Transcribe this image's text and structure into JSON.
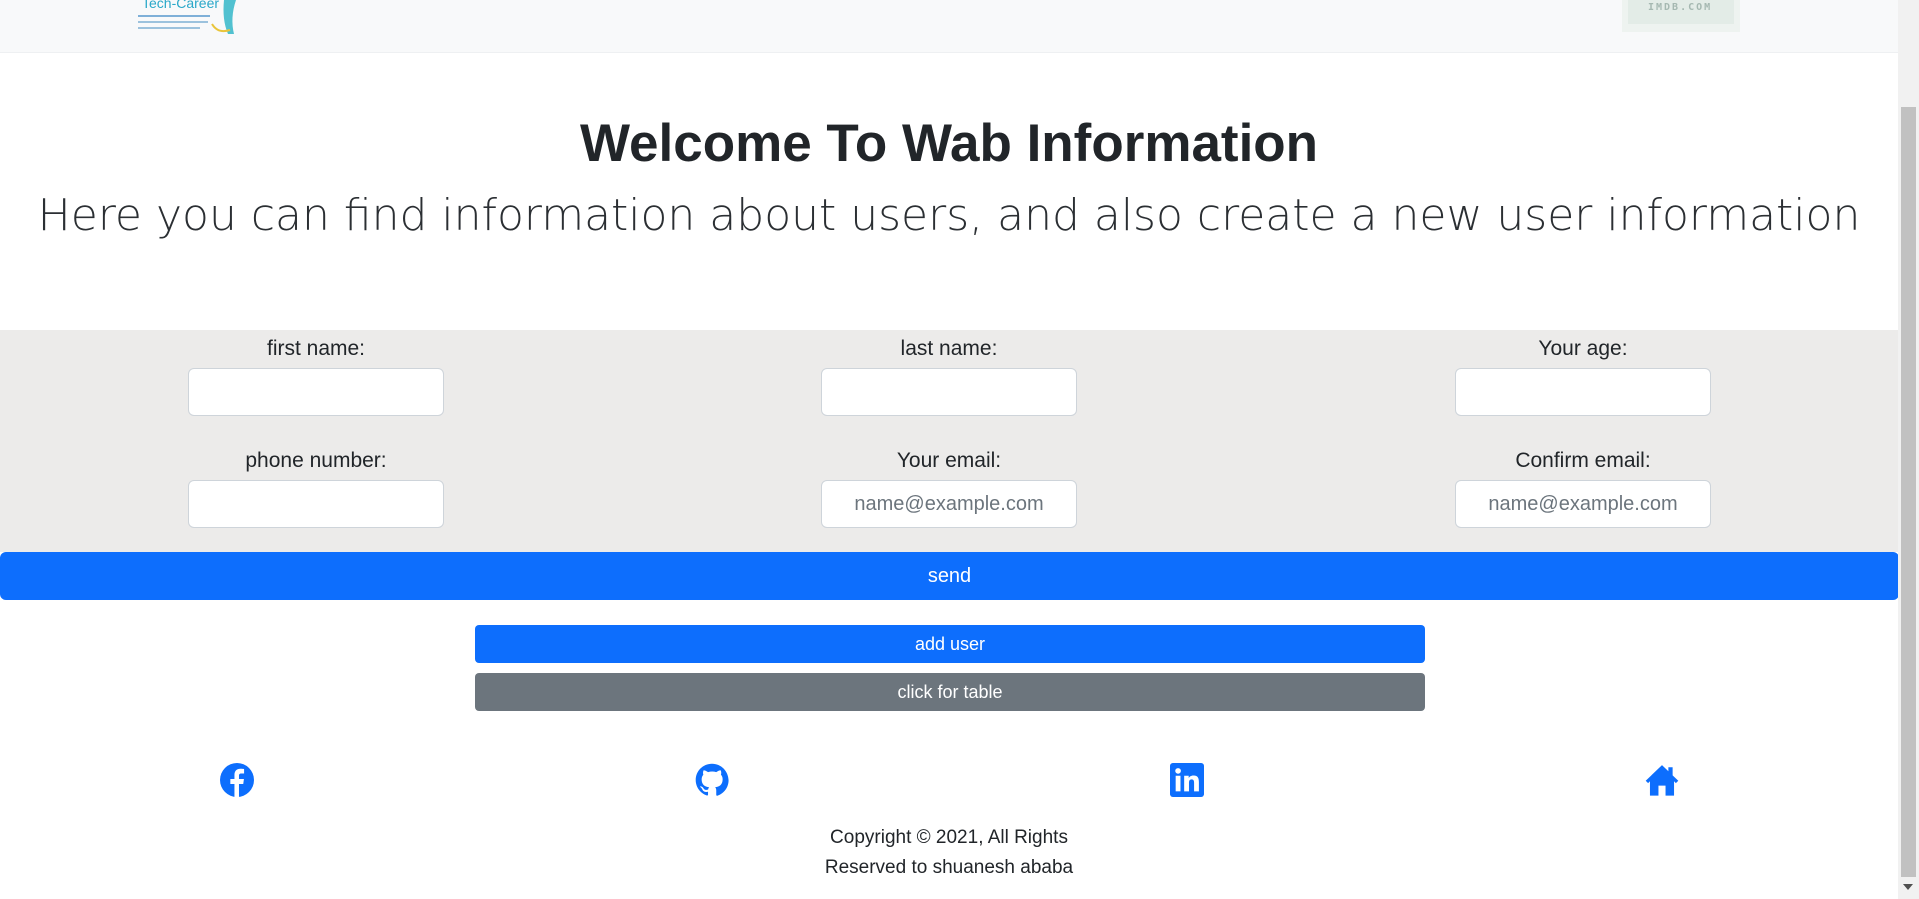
{
  "navbar": {
    "logo_left_alt": "Tech-Career",
    "logo_right_text": "IMDB.COM"
  },
  "header": {
    "title": "Welcome To Wab Information",
    "subtitle": "Here you can find information about users, and also create a new user information"
  },
  "form": {
    "fields": [
      {
        "label": "first name:",
        "placeholder": "",
        "value": ""
      },
      {
        "label": "last name:",
        "placeholder": "",
        "value": ""
      },
      {
        "label": "Your age:",
        "placeholder": "",
        "value": ""
      },
      {
        "label": "phone number:",
        "placeholder": "",
        "value": ""
      },
      {
        "label": "Your email:",
        "placeholder": "name@example.com",
        "value": ""
      },
      {
        "label": "Confirm email:",
        "placeholder": "name@example.com",
        "value": ""
      }
    ],
    "send_label": "send"
  },
  "actions": {
    "add_user_label": "add user",
    "table_label": "click for table"
  },
  "footer": {
    "social_icons": [
      "facebook-icon",
      "github-icon",
      "linkedin-icon",
      "home-icon"
    ],
    "copyright_line1": "Copyright © 2021, All Rights",
    "copyright_line2": "Reserved to shuanesh ababa"
  },
  "colors": {
    "primary": "#0d6efd",
    "secondary": "#6c757d",
    "form_band": "#ecebea",
    "navbar": "#f8f9fa"
  }
}
